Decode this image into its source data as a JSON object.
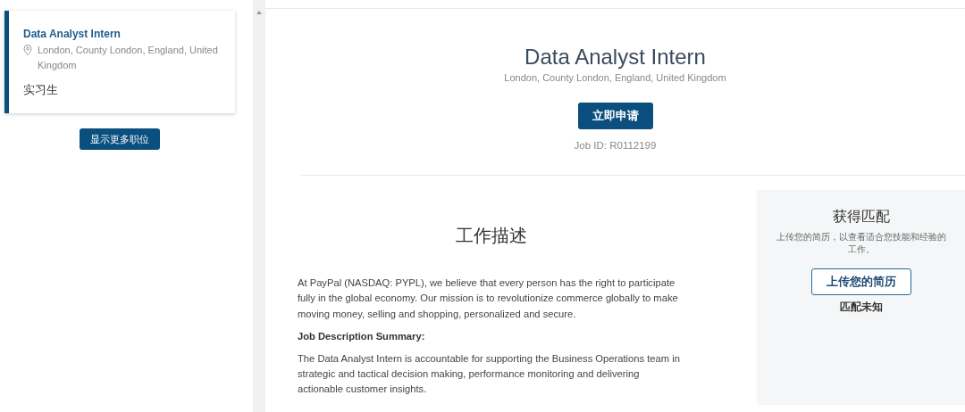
{
  "job_list": [
    {
      "title": "Data Analyst Intern",
      "location": "London, County London, England, United Kingdom",
      "type": "实习生",
      "selected": true
    }
  ],
  "show_more_button": "显示更多职位",
  "job": {
    "title": "Data Analyst Intern",
    "location": "London, County London, England, United Kingdom",
    "apply_button": "立即申请",
    "job_id": "Job ID: R0112199"
  },
  "description": {
    "heading": "工作描述",
    "blocks": [
      {
        "kind": "paragraph",
        "text": "At PayPal (NASDAQ: PYPL), we believe that every person has the right to participate fully in the global economy. Our mission is to revolutionize commerce globally to make moving money, selling and shopping, personalized and secure."
      },
      {
        "kind": "subheading",
        "text": "Job Description Summary:"
      },
      {
        "kind": "paragraph",
        "text": "The Data Analyst Intern is accountable for supporting the Business Operations team in strategic and tactical decision making, performance monitoring and delivering actionable customer insights."
      }
    ]
  },
  "match_panel": {
    "title": "获得匹配",
    "text": "上传您的简历，以查看适合您技能和经验的工作。",
    "upload_button": "上传您的简历",
    "status": "匹配未知"
  }
}
